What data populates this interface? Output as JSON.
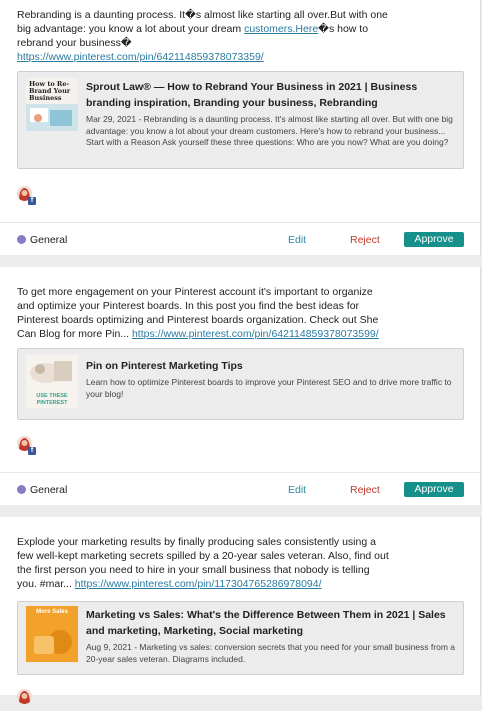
{
  "posts": [
    {
      "text_before_mid": "Rebranding is a daunting process. It�s almost like starting all over.But with one big advantage: you know a lot about your dream ",
      "mid_link": "customers.Here",
      "text_after_mid": "�s how to rebrand your business�",
      "link": "https://www.pinterest.com/pin/642114859378073359/",
      "preview": {
        "title": "Sprout Law® — How to Rebrand Your Business in 2021 | Business branding inspiration, Branding your business, Rebranding",
        "description": "Mar 29, 2021 - Rebranding is a daunting process.  It's almost like starting all over. But with one big advantage: you know a lot about your dream customers. Here's how to rebrand your business... Start with a Reason Ask yourself these three questions:  Who are you now? What are you doing?",
        "thumb_caption": "How to Re-Brand Your Business"
      },
      "category": "General",
      "edit_label": "Edit",
      "reject_label": "Reject",
      "approve_label": "Approve"
    },
    {
      "text": "To get more engagement on your Pinterest account it's important to organize and optimize your Pinterest boards. In this post you find the best ideas for Pinterest boards optimizing and Pinterest boards organization. Check out She Can Blog for more Pin... ",
      "link": "https://www.pinterest.com/pin/642114859378073599/",
      "preview": {
        "title": "Pin on Pinterest Marketing Tips",
        "description": "Learn how to optimize Pinterest boards to improve your Pinterest SEO and to drive more traffic to your blog!",
        "thumb_caption": "USE THESE PINTEREST"
      },
      "category": "General",
      "edit_label": "Edit",
      "reject_label": "Reject",
      "approve_label": "Approve"
    },
    {
      "text": "Explode your marketing results by finally producing sales consistently using a few well-kept marketing secrets spilled by a 20-year sales veteran. Also, find out the first person you need to hire in your small business that nobody is telling you. #mar... ",
      "link": "https://www.pinterest.com/pin/117304765286978094/",
      "preview": {
        "title": "Marketing vs Sales: What's the Difference Between Them in 2021 | Sales and marketing, Marketing, Social marketing",
        "description": "Aug 9, 2021 - Marketing vs sales: conversion secrets that you need for your small business from a 20-year sales veteran. Diagrams included.",
        "thumb_caption": "More Sales"
      }
    }
  ],
  "colors": {
    "link": "#2a7aa0",
    "edit": "#2a8aa0",
    "reject": "#c0392b",
    "approve_bg": "#15908a",
    "category_dot": "#8b7bc4",
    "facebook": "#3b5998"
  },
  "icons": {
    "network": "facebook-icon",
    "category": "category-dot-icon"
  }
}
